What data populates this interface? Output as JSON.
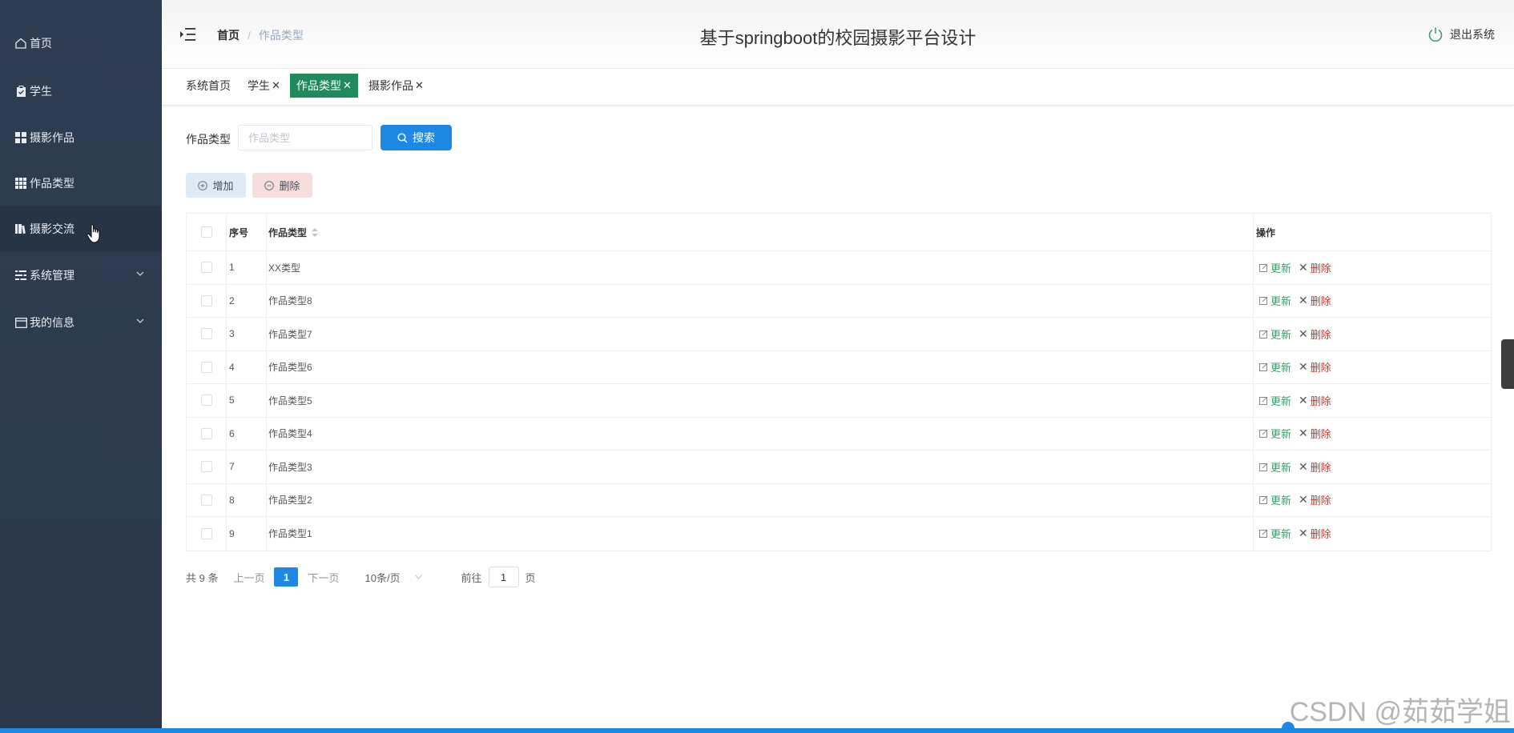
{
  "sidebar": {
    "items": [
      {
        "label": "首页",
        "icon": "home-icon"
      },
      {
        "label": "学生",
        "icon": "clipboard-icon"
      },
      {
        "label": "摄影作品",
        "icon": "grid-icon"
      },
      {
        "label": "作品类型",
        "icon": "apps-icon"
      },
      {
        "label": "摄影交流",
        "icon": "book-icon"
      },
      {
        "label": "系统管理",
        "icon": "list-icon"
      },
      {
        "label": "我的信息",
        "icon": "card-icon"
      }
    ]
  },
  "header": {
    "breadcrumb_home": "首页",
    "breadcrumb_sep": "/",
    "breadcrumb_current": "作品类型",
    "title": "基于springboot的校园摄影平台设计",
    "logout": "退出系统"
  },
  "tags": [
    {
      "label": "系统首页",
      "closable": false
    },
    {
      "label": "学生",
      "closable": true
    },
    {
      "label": "作品类型",
      "closable": true,
      "active": true
    },
    {
      "label": "摄影作品",
      "closable": true
    }
  ],
  "search": {
    "label": "作品类型",
    "placeholder": "作品类型",
    "button": "搜索"
  },
  "actions": {
    "add": "增加",
    "delete": "删除"
  },
  "table": {
    "headers": {
      "index": "序号",
      "type": "作品类型",
      "ops": "操作"
    },
    "rows": [
      {
        "index": "1",
        "type": "XX类型"
      },
      {
        "index": "2",
        "type": "作品类型8"
      },
      {
        "index": "3",
        "type": "作品类型7"
      },
      {
        "index": "4",
        "type": "作品类型6"
      },
      {
        "index": "5",
        "type": "作品类型5"
      },
      {
        "index": "6",
        "type": "作品类型4"
      },
      {
        "index": "7",
        "type": "作品类型3"
      },
      {
        "index": "8",
        "type": "作品类型2"
      },
      {
        "index": "9",
        "type": "作品类型1"
      }
    ],
    "update_label": "更新",
    "delete_label": "删除"
  },
  "pagination": {
    "total": "共 9 条",
    "prev": "上一页",
    "page": "1",
    "next": "下一页",
    "size": "10条/页",
    "goto_label": "前往",
    "goto_value": "1",
    "goto_suffix": "页"
  },
  "watermark": "CSDN @茹茹学姐",
  "colors": {
    "sidebar": "#2f3d52",
    "primary": "#1e88e5",
    "active_tag": "#1f8a5b",
    "update": "#3a9d6c",
    "delete": "#c0392b"
  }
}
